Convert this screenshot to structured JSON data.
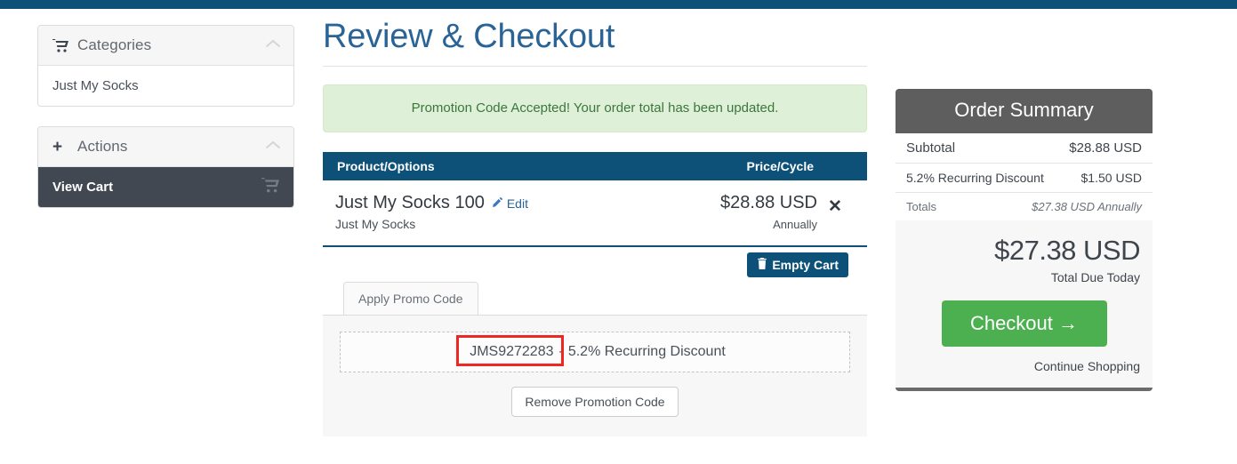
{
  "topbar": {
    "color": "#0d5179"
  },
  "sidebar": {
    "categories_panel": {
      "icon": "cart-icon",
      "title": "Categories",
      "collapse_icon": "chevron-up-icon",
      "items": [
        {
          "label": "Just My Socks"
        }
      ]
    },
    "actions_panel": {
      "icon": "plus-icon",
      "title": "Actions",
      "collapse_icon": "chevron-up-icon",
      "items": [
        {
          "label": "View Cart",
          "icon": "cart-icon",
          "active": true
        }
      ]
    }
  },
  "main": {
    "page_title": "Review & Checkout",
    "alert": {
      "text": "Promotion Code Accepted! Your order total has been updated.",
      "bg": "#dff0d8",
      "color": "#3c763d"
    },
    "cart_table": {
      "headers": {
        "product": "Product/Options",
        "price": "Price/Cycle"
      },
      "header_bg": "#0d5179",
      "rows": [
        {
          "name": "Just My Socks 100",
          "edit_label": "Edit",
          "edit_icon": "pencil-icon",
          "sub": "Just My Socks",
          "price": "$28.88 USD",
          "cycle": "Annually",
          "remove_icon": "close-x-icon"
        }
      ]
    },
    "empty_cart_button": {
      "label": "Empty Cart",
      "icon": "trash-icon"
    },
    "tabs": [
      {
        "label": "Apply Promo Code",
        "active": true
      }
    ],
    "promo": {
      "code": "JMS9272283",
      "separator": "-",
      "description": "5.2% Recurring Discount",
      "remove_button": "Remove Promotion Code"
    },
    "annotation": {
      "color": "#ee2722",
      "target": "promo-code"
    }
  },
  "order_summary": {
    "title": "Order Summary",
    "rows": [
      {
        "label": "Subtotal",
        "value": "$28.88 USD"
      },
      {
        "label": "5.2% Recurring Discount",
        "value": "$1.50 USD"
      },
      {
        "label": "Totals",
        "value": "$27.38 USD Annually"
      }
    ],
    "total": "$27.38 USD",
    "total_caption": "Total Due Today",
    "checkout_button": {
      "label": "Checkout",
      "icon": "arrow-right-icon",
      "color": "#4caf50"
    },
    "continue_shopping": "Continue Shopping"
  }
}
